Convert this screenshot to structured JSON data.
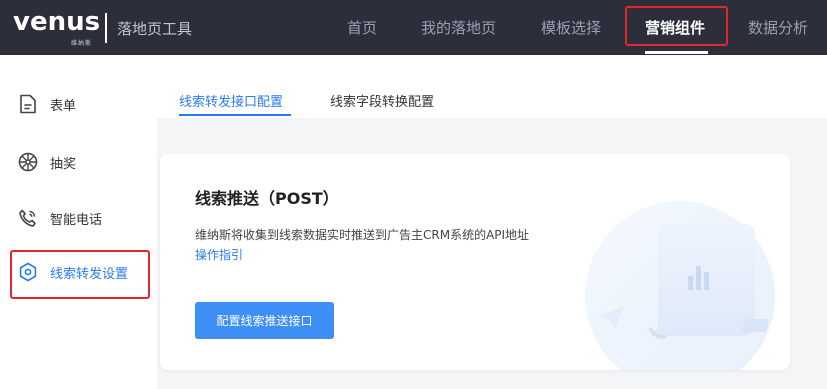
{
  "header": {
    "logo_text": "VENUS",
    "logo_subtext": "维纳斯",
    "product_name": "落地页工具",
    "nav": [
      {
        "label": "首页",
        "active": false
      },
      {
        "label": "我的落地页",
        "active": false
      },
      {
        "label": "模板选择",
        "active": false
      },
      {
        "label": "营销组件",
        "active": true
      },
      {
        "label": "数据分析",
        "active": false
      }
    ]
  },
  "sidebar": {
    "items": [
      {
        "label": "表单",
        "icon": "form-icon",
        "active": false
      },
      {
        "label": "抽奖",
        "icon": "lottery-icon",
        "active": false
      },
      {
        "label": "智能电话",
        "icon": "phone-icon",
        "active": false
      },
      {
        "label": "线索转发设置",
        "icon": "settings-hexagon-icon",
        "active": true
      }
    ]
  },
  "tabs": [
    {
      "label": "线索转发接口配置",
      "active": true
    },
    {
      "label": "线索字段转换配置",
      "active": false
    }
  ],
  "card": {
    "title": "线索推送（POST）",
    "description": "维纳斯将收集到线索数据实时推送到广告主CRM系统的API地址",
    "link": "操作指引",
    "button": "配置线索推送接口",
    "illustration_icon": "document-chart-icon"
  },
  "colors": {
    "topbar": "#2c2f3b",
    "accent": "#2a7af3",
    "button": "#3d8ef5",
    "highlight": "#e3252c"
  }
}
